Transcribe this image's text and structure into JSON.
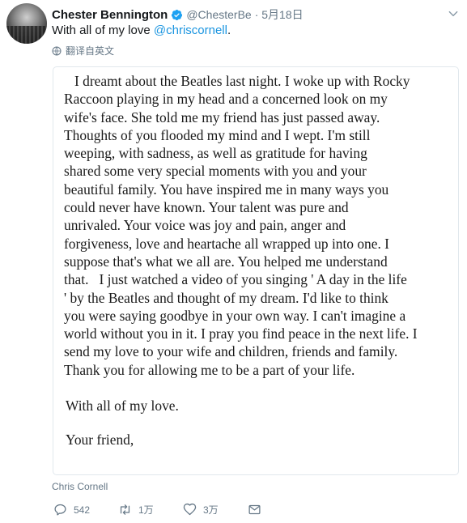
{
  "author": {
    "name": "Chester Bennington",
    "handle": "@ChesterBe",
    "date": "· 5月18日"
  },
  "tweet": {
    "text": "With all of my love",
    "mention": "@chriscornell",
    "trailing": "."
  },
  "translate_label": "翻译自英文",
  "letter": {
    "lines": [
      "   I dreamt about the Beatles last night. I woke up with Rocky",
      "Raccoon playing in my head and a concerned look on my",
      "wife's face. She told me my friend has just passed away.",
      "Thoughts of you flooded my mind and I wept. I'm still",
      "weeping, with sadness, as well as gratitude for having",
      "shared some very special moments with you and your",
      "beautiful family. You have inspired me in many ways you",
      "could never have known. Your talent was pure and",
      "unrivaled. Your voice was joy and pain, anger and",
      "forgiveness, love and heartache all wrapped up into one. I",
      "suppose that's what we all are. You helped me understand",
      "that.   I just watched a video of you singing ' A day in the life",
      "' by the Beatles and thought of my dream. I'd like to think",
      "you were saying goodbye in your own way. I can't imagine a",
      "world without you in it. I pray you find peace in the next life. I",
      "send my love to your wife and children, friends and family.",
      "Thank you for allowing me to be a part of your life."
    ],
    "closing": "With all of my love.",
    "signoff": "Your friend,"
  },
  "credit": "Chris Cornell",
  "actions": {
    "replies": "542",
    "retweets": "1万",
    "likes": "3万"
  },
  "colors": {
    "link": "#1b95e0",
    "secondary_text": "#657786",
    "verified": "#1da1f2"
  },
  "icons": [
    "verified-badge-icon",
    "chevron-down-icon",
    "globe-icon",
    "reply-icon",
    "retweet-icon",
    "like-icon",
    "message-icon"
  ]
}
